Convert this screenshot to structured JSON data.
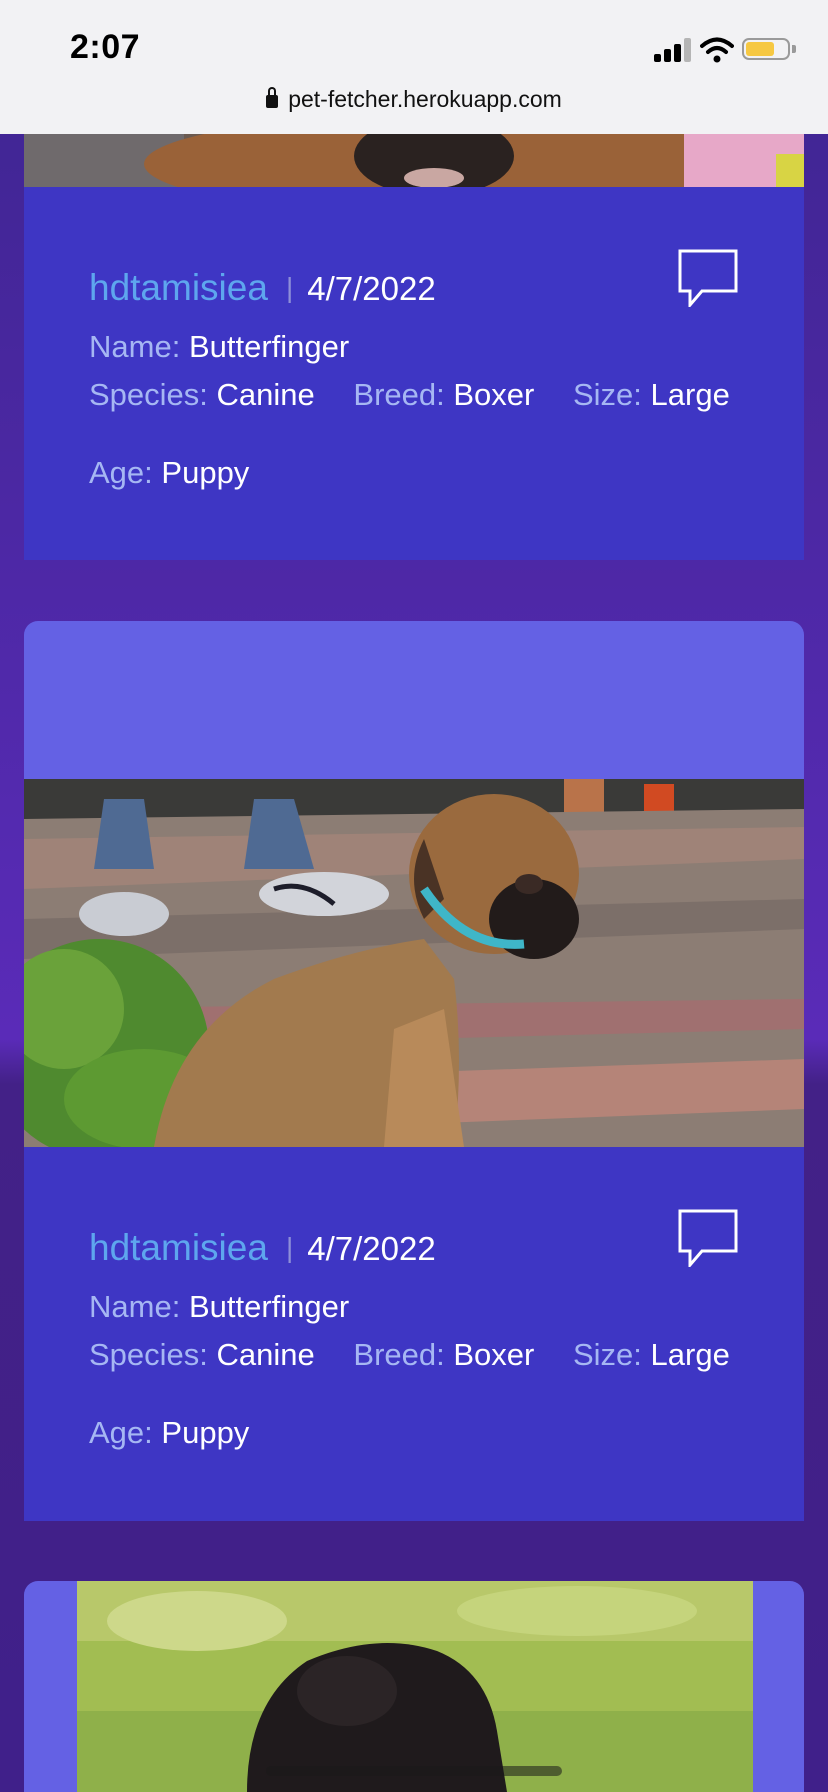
{
  "status_bar": {
    "time": "2:07",
    "url": "pet-fetcher.herokuapp.com",
    "battery_fraction": 0.7
  },
  "labels": {
    "name": "Name:",
    "species": "Species:",
    "breed": "Breed:",
    "size": "Size:",
    "age": "Age:",
    "separator": "|"
  },
  "posts": [
    {
      "username": "hdtamisiea",
      "date": "4/7/2022",
      "name": "Butterfinger",
      "species": "Canine",
      "breed": "Boxer",
      "size": "Large",
      "age": "Puppy"
    },
    {
      "username": "hdtamisiea",
      "date": "4/7/2022",
      "name": "Butterfinger",
      "species": "Canine",
      "breed": "Boxer",
      "size": "Large",
      "age": "Puppy"
    }
  ],
  "colors": {
    "page_background": "#41208a",
    "card_info": "#3e36c4",
    "card_header": "#6461e4",
    "username": "#5ea6ee",
    "field_label": "#a6b7f3"
  },
  "icons": {
    "comment": "comment-bubble-icon",
    "lock": "lock-icon"
  }
}
